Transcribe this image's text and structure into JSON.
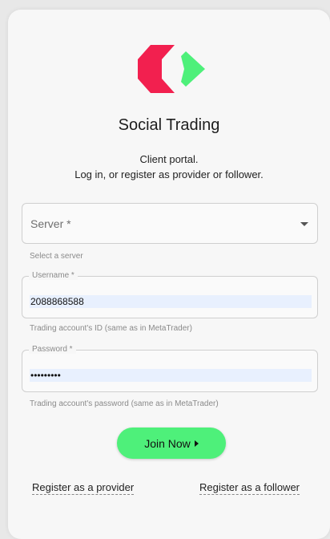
{
  "app": {
    "title": "Social Trading",
    "subtitle_line1": "Client portal.",
    "subtitle_line2": "Log in, or register as provider or follower."
  },
  "colors": {
    "logo_red": "#f2204f",
    "logo_green": "#4ef07a",
    "button_green": "#4ef07a",
    "autofill_bg": "#e8f0fe"
  },
  "form": {
    "server": {
      "label": "Server *",
      "helper": "Select a server",
      "icon": "dropdown-arrow-icon"
    },
    "username": {
      "label": "Username *",
      "value": "2088868588",
      "helper": "Trading account's ID (same as in MetaTrader)"
    },
    "password": {
      "label": "Password *",
      "value": "•••••••••",
      "helper": "Trading account's password (same as in MetaTrader)"
    },
    "submit_label": "Join Now"
  },
  "links": {
    "provider": "Register as a provider",
    "follower": "Register as a follower"
  }
}
